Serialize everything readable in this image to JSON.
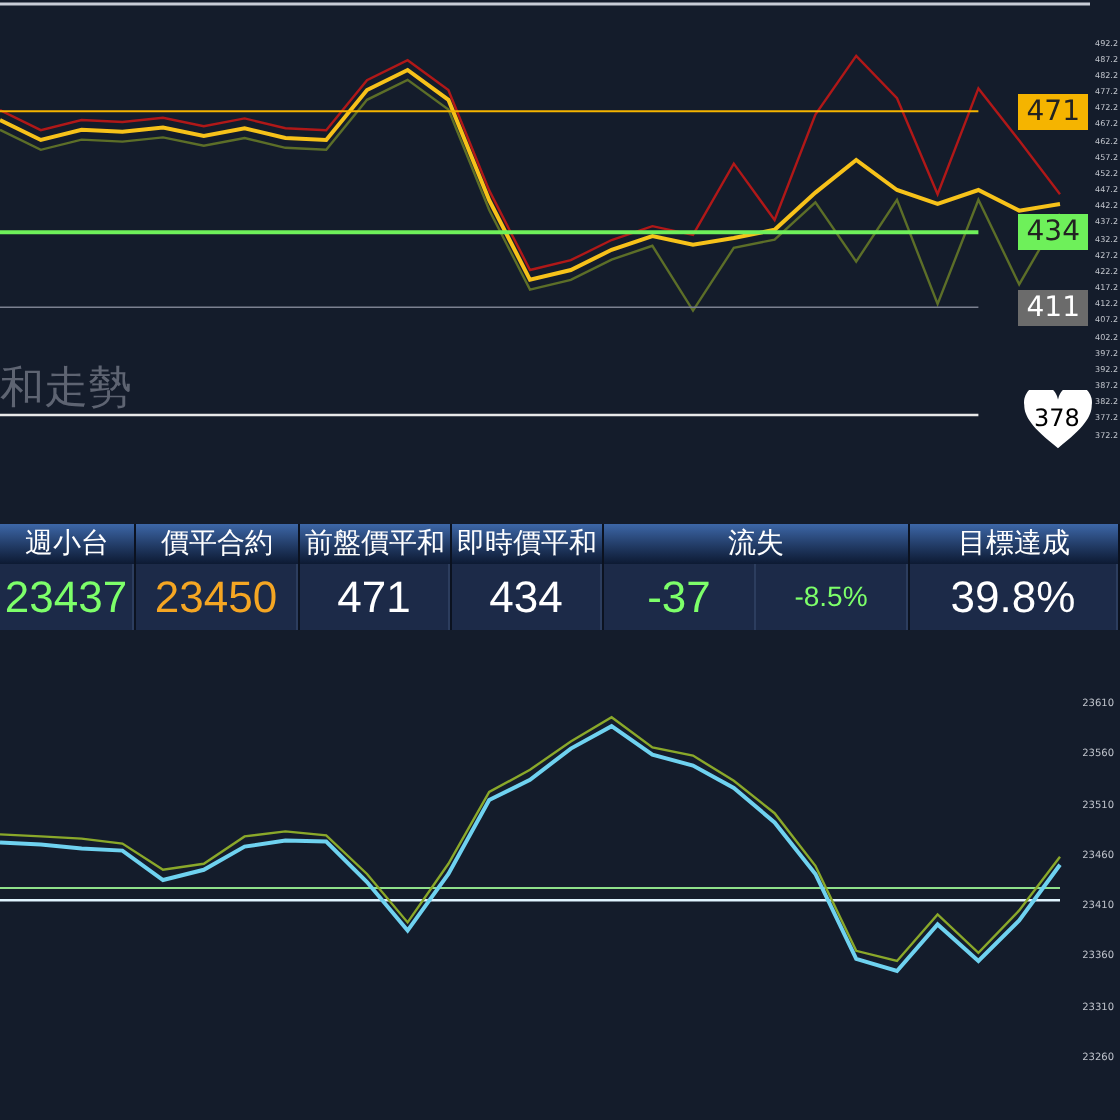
{
  "top_chart": {
    "title": "和走勢",
    "chart_data": {
      "type": "line",
      "ylim": [
        372.2,
        492.2
      ],
      "yticks": [
        492.2,
        487.2,
        482.2,
        477.2,
        472.2,
        467.2,
        462.2,
        457.2,
        452.2,
        447.2,
        442.2,
        437.2,
        432.2,
        427.2,
        422.2,
        417.2,
        412.2,
        407.2,
        402.2,
        397.2,
        392.2,
        387.2,
        382.2,
        377.2,
        372.2
      ],
      "series": [
        {
          "color": "#b01818",
          "values": [
            471.3,
            465.2,
            468.3,
            467.7,
            469.0,
            466.4,
            468.8,
            465.8,
            465.2,
            480.5,
            486.6,
            477.5,
            446.8,
            422.4,
            425.4,
            431.6,
            435.8,
            433.2,
            455.0,
            437.7,
            470.0,
            488.0,
            475.0,
            445.6,
            478.0,
            462.0,
            445.6
          ]
        },
        {
          "color": "#5c6e28",
          "values": [
            465.3,
            459.2,
            462.3,
            461.7,
            463.0,
            460.4,
            462.8,
            459.8,
            459.2,
            474.5,
            480.6,
            471.5,
            440.8,
            416.4,
            419.4,
            425.6,
            429.8,
            410.0,
            429.2,
            431.7,
            443.1,
            425.0,
            443.9,
            412.0,
            443.9,
            418.0,
            439.6
          ]
        },
        {
          "color": "#f7c21a",
          "values": [
            468.3,
            462.2,
            465.3,
            464.7,
            466.0,
            463.4,
            465.8,
            462.8,
            462.2,
            477.5,
            483.6,
            474.5,
            443.8,
            419.4,
            422.4,
            428.6,
            432.8,
            430.2,
            432.2,
            434.7,
            446.1,
            456.1,
            446.9,
            442.6,
            446.9,
            440.6,
            442.6
          ]
        },
        {
          "color": "#f5b400",
          "values": [
            471,
            471,
            471,
            471,
            471,
            471,
            471,
            471,
            471,
            471,
            471,
            471,
            471,
            471,
            471,
            471,
            471,
            471,
            471,
            471,
            471,
            471,
            471,
            471,
            471,
            null,
            null
          ]
        },
        {
          "color": "#7b8090",
          "values": [
            411,
            411,
            411,
            411,
            411,
            411,
            411,
            411,
            411,
            411,
            411,
            411,
            411,
            411,
            411,
            411,
            411,
            411,
            411,
            411,
            411,
            411,
            411,
            411,
            411,
            null,
            null
          ]
        },
        {
          "color": "#e8e8e8",
          "values": [
            378,
            378,
            378,
            378,
            378,
            378,
            378,
            378,
            378,
            378,
            378,
            378,
            378,
            378,
            378,
            378,
            378,
            378,
            378,
            378,
            378,
            378,
            378,
            378,
            378,
            null,
            null
          ]
        },
        {
          "color": "#6ef05a",
          "values": [
            434,
            434,
            434,
            434,
            434,
            434,
            434,
            434,
            434,
            434,
            434,
            434,
            434,
            434,
            434,
            434,
            434,
            434,
            434,
            434,
            434,
            434,
            434,
            434,
            434,
            null,
            null
          ]
        }
      ]
    },
    "levels": [
      {
        "value": "471",
        "kind": "tag",
        "color": "#f5b400"
      },
      {
        "value": "434",
        "kind": "tag",
        "color": "#6ef05a"
      },
      {
        "value": "411",
        "kind": "tag",
        "color": "#6b6b6b"
      },
      {
        "value": "378",
        "kind": "heart",
        "color": "#ffffff"
      }
    ]
  },
  "summary": [
    {
      "label": "週小台",
      "values": [
        {
          "text": "23437",
          "color": "#7dff6a"
        }
      ]
    },
    {
      "label": "價平合約",
      "values": [
        {
          "text": "23450",
          "color": "#f5a623"
        }
      ]
    },
    {
      "label": "前盤價平和",
      "values": [
        {
          "text": "471",
          "color": "#ffffff"
        }
      ]
    },
    {
      "label": "即時價平和",
      "values": [
        {
          "text": "434",
          "color": "#ffffff"
        }
      ]
    },
    {
      "label": "流失",
      "values": [
        {
          "text": "-37",
          "color": "#7dff6a"
        },
        {
          "text": "-8.5%",
          "color": "#7dff6a"
        }
      ]
    },
    {
      "label": "目標達成",
      "values": [
        {
          "text": "39.8%",
          "color": "#ffffff"
        }
      ]
    }
  ],
  "bottom_chart": {
    "chart_data": {
      "type": "line",
      "ylim": [
        23260,
        23610
      ],
      "yticks": [
        23610,
        23560,
        23510,
        23460,
        23410,
        23360,
        23310,
        23260
      ],
      "series": [
        {
          "color": "#8fe08a",
          "values": [
            23428,
            23428,
            23428,
            23428,
            23428,
            23428,
            23428,
            23428,
            23428,
            23428,
            23428,
            23428,
            23428,
            23428,
            23428,
            23428,
            23428,
            23428,
            23428,
            23428,
            23428,
            23428,
            23428,
            23428,
            23428,
            23428,
            23428
          ]
        },
        {
          "color": "#e0f4ff",
          "values": [
            23416,
            23416,
            23416,
            23416,
            23416,
            23416,
            23416,
            23416,
            23416,
            23416,
            23416,
            23416,
            23416,
            23416,
            23416,
            23416,
            23416,
            23416,
            23416,
            23416,
            23416,
            23416,
            23416,
            23416,
            23416,
            23416,
            23416
          ]
        },
        {
          "color": "#8aa82a",
          "values": [
            23481,
            23479,
            23477,
            23472,
            23446,
            23452,
            23479,
            23484,
            23480,
            23442,
            23394,
            23452,
            23523,
            23545,
            23573,
            23597,
            23567,
            23559,
            23534,
            23502,
            23450,
            23366,
            23356,
            23402,
            23364,
            23406,
            23459
          ]
        },
        {
          "color": "#6fd2f0",
          "values": [
            23473,
            23471,
            23467,
            23465,
            23436,
            23446,
            23469,
            23475,
            23474,
            23434,
            23386,
            23442,
            23515,
            23535,
            23566,
            23588,
            23560,
            23549,
            23527,
            23493,
            23442,
            23358,
            23346,
            23392,
            23356,
            23396,
            23451
          ]
        }
      ]
    }
  }
}
